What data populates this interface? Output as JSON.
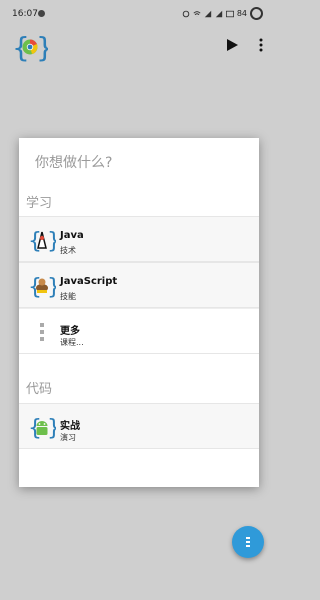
{
  "status_bar": {
    "time": "16:07",
    "battery": "84"
  },
  "app": {
    "logo_icon": "braces-chrome-logo-icon",
    "play_icon": "play-icon",
    "menu_icon": "more-vert-icon"
  },
  "dialog": {
    "prompt": "你想做什么?",
    "sections": [
      {
        "title": "学习",
        "items": [
          {
            "title": "Java",
            "subtitle": "技术",
            "icon": "java-icon"
          },
          {
            "title": "JavaScript",
            "subtitle": "技能",
            "icon": "javascript-icon"
          },
          {
            "title": "更多",
            "subtitle": "课程...",
            "icon": "more-dots-icon"
          }
        ]
      },
      {
        "title": "代码",
        "items": [
          {
            "title": "实战",
            "subtitle": "演习",
            "icon": "android-icon"
          }
        ]
      }
    ]
  },
  "fab": {
    "icon": "menu-dots-icon"
  },
  "colors": {
    "accent": "#2f9ad9",
    "brace_blue": "#2d7fb8",
    "green": "#6dbf4b"
  }
}
